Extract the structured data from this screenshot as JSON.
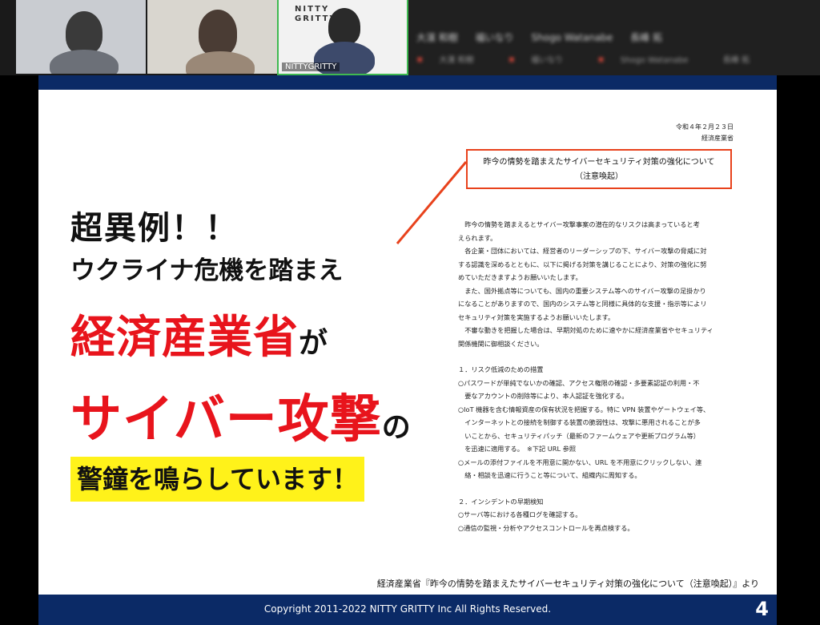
{
  "participants": [
    {
      "name": ""
    },
    {
      "name": ""
    },
    {
      "name": "NITTYGRITTY",
      "logo": "NITTY GRITTY"
    },
    {
      "name": ""
    }
  ],
  "panel": {
    "row1": [
      "大濱 和樹",
      "福いなり",
      "Shogo Watanabe",
      "長峰 拓"
    ],
    "row2": [
      "大濱 和樹",
      "福いなり",
      "Shogo Watanabe",
      "長峰 拓"
    ]
  },
  "slide": {
    "headline1": "超異例！！",
    "headline2": "ウクライナ危機を踏まえ",
    "headline3_red": "経済産業省",
    "headline3_black": "が",
    "headline4_red": "サイバー攻撃",
    "headline4_black": "の",
    "headline5": "警鐘を鳴らしています！",
    "doc": {
      "date": "令和４年２月２３日",
      "issuer": "経済産業省",
      "title_line1": "昨今の情勢を踏まえたサイバーセキュリティ対策の強化について",
      "title_line2": "（注意喚起）",
      "paragraphs": [
        "　昨今の情勢を踏まえるとサイバー攻撃事案の潜在的なリスクは高まっていると考",
        "えられます。",
        "　各企業・団体においては、経営者のリーダーシップの下、サイバー攻撃の脅威に対",
        "する認識を深めるとともに、以下に掲げる対策を講じることにより、対策の強化に努",
        "めていただきますようお願いいたします。",
        "　また、国外拠点等についても、国内の重要システム等へのサイバー攻撃の足掛かり",
        "になることがありますので、国内のシステム等と同様に具体的な支援・指示等によリ",
        "セキュリティ対策を実施するようお願いいたします。",
        "　不審な動きを把握した場合は、早期対処のために速やかに経済産業省やセキュリティ",
        "関係機関に御相談ください。"
      ],
      "section1_title": "１．リスク低減のための措置",
      "section1_items": [
        "○パスワードが単純でないかの確認、アクセス権限の確認・多要素認証の利用・不",
        "　要なアカウントの削除等により、本人認証を強化する。",
        "○IoT 機器を含む情報資産の保有状況を把握する。特に VPN 装置やゲートウェイ等、",
        "　インターネットとの接続を制御する装置の脆弱性は、攻撃に悪用されることが多",
        "　いことから、セキュリティパッチ（最新のファームウェアや更新プログラム等）",
        "　を迅速に適用する。　※下記 URL 参照",
        "○メールの添付ファイルを不用意に開かない、URL を不用意にクリックしない、連",
        "　絡・相談を迅速に行うこと等について、組織内に周知する。"
      ],
      "section2_title": "２．インシデントの早期検知",
      "section2_items": [
        "○サーバ等における各種ログを確認する。",
        "○通信の監視・分析やアクセスコントロールを再点検する。"
      ]
    },
    "source": "経済産業省『昨今の情勢を踏まえたサイバーセキュリティ対策の強化について（注意喚起）』より",
    "footer": "Copyright 2011-2022 NITTY GRITTY Inc All Rights Reserved.",
    "page_number": "4"
  },
  "colors": {
    "navy": "#0b2a66",
    "red": "#e8141c",
    "highlight": "#fff21a",
    "callout": "#e8421c"
  }
}
